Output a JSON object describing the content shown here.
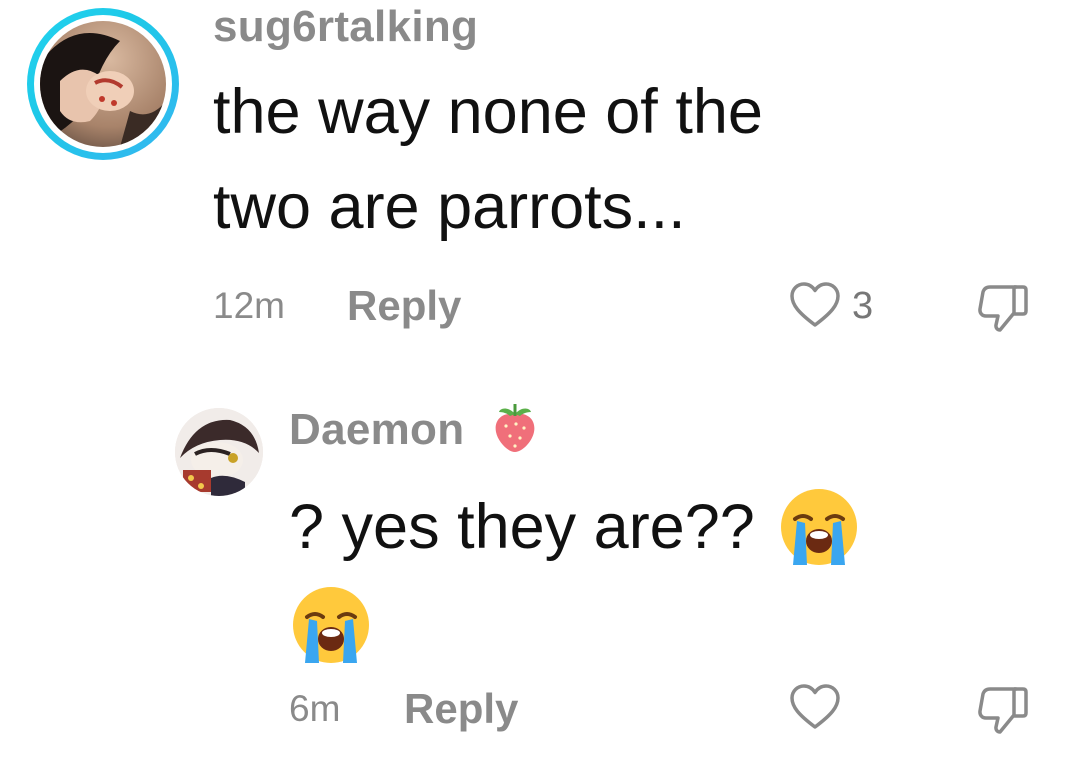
{
  "comment": {
    "username": "sug6rtalking",
    "text_lines": [
      "the way none of the",
      "two are parrots..."
    ],
    "time": "12m",
    "reply_label": "Reply",
    "like_count": "3",
    "avatar_ring_color": "#1ec8e8"
  },
  "reply": {
    "username": "Daemon",
    "username_emoji": "strawberry-icon",
    "text": "? yes they are??",
    "emoji": "loudly-crying-face",
    "time": "6m",
    "reply_label": "Reply"
  },
  "colors": {
    "muted_text": "#8a8a8a",
    "body_text": "#111111",
    "background": "#ffffff"
  }
}
